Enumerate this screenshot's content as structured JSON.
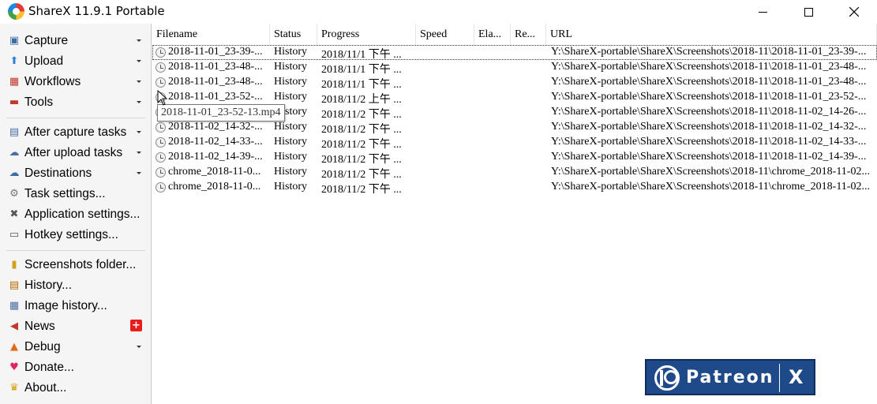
{
  "window": {
    "title": "ShareX 11.9.1 Portable",
    "icons": {
      "app": "sharex-logo-icon",
      "minimize": "minimize-icon",
      "maximize": "maximize-icon",
      "close": "close-icon"
    }
  },
  "sidebar": {
    "groups": [
      [
        {
          "label": "Capture",
          "icon": "capture-icon",
          "submenu": true
        },
        {
          "label": "Upload",
          "icon": "upload-arrow-icon",
          "submenu": true
        },
        {
          "label": "Workflows",
          "icon": "workflows-grid-icon",
          "submenu": true
        },
        {
          "label": "Tools",
          "icon": "toolbox-icon",
          "submenu": true
        }
      ],
      [
        {
          "label": "After capture tasks",
          "icon": "after-capture-icon",
          "submenu": true
        },
        {
          "label": "After upload tasks",
          "icon": "after-upload-icon",
          "submenu": true
        },
        {
          "label": "Destinations",
          "icon": "cloud-destinations-icon",
          "submenu": true
        },
        {
          "label": "Task settings...",
          "icon": "gear-icon",
          "submenu": false
        },
        {
          "label": "Application settings...",
          "icon": "wrench-screwdriver-icon",
          "submenu": false
        },
        {
          "label": "Hotkey settings...",
          "icon": "keyboard-icon",
          "submenu": false
        }
      ],
      [
        {
          "label": "Screenshots folder...",
          "icon": "folder-icon",
          "submenu": false
        },
        {
          "label": "History...",
          "icon": "history-list-icon",
          "submenu": false
        },
        {
          "label": "Image history...",
          "icon": "image-history-icon",
          "submenu": false
        },
        {
          "label": "News",
          "icon": "megaphone-icon",
          "submenu": false,
          "badge": "+"
        },
        {
          "label": "Debug",
          "icon": "traffic-cone-icon",
          "submenu": true
        },
        {
          "label": "Donate...",
          "icon": "heart-icon",
          "submenu": false
        },
        {
          "label": "About...",
          "icon": "crown-icon",
          "submenu": false
        }
      ]
    ]
  },
  "list": {
    "columns": [
      "Filename",
      "Status",
      "Progress",
      "Speed",
      "Ela...",
      "Re...",
      "URL"
    ],
    "rows": [
      [
        "2018-11-01_23-39-...",
        "History",
        "2018/11/1 下午 ...",
        "",
        "",
        "",
        "Y:\\ShareX-portable\\ShareX\\Screenshots\\2018-11\\2018-11-01_23-39-..."
      ],
      [
        "2018-11-01_23-48-...",
        "History",
        "2018/11/1 下午 ...",
        "",
        "",
        "",
        "Y:\\ShareX-portable\\ShareX\\Screenshots\\2018-11\\2018-11-01_23-48-..."
      ],
      [
        "2018-11-01_23-48-...",
        "History",
        "2018/11/1 下午 ...",
        "",
        "",
        "",
        "Y:\\ShareX-portable\\ShareX\\Screenshots\\2018-11\\2018-11-01_23-48-..."
      ],
      [
        "2018-11-01_23-52-...",
        "History",
        "2018/11/2 上午 ...",
        "",
        "",
        "",
        "Y:\\ShareX-portable\\ShareX\\Screenshots\\2018-11\\2018-11-01_23-52-..."
      ],
      [
        "2018-11-01_23-52-13.mp4",
        "History",
        "2018/11/2 下午 ...",
        "",
        "",
        "",
        "Y:\\ShareX-portable\\ShareX\\Screenshots\\2018-11\\2018-11-02_14-26-..."
      ],
      [
        "2018-11-02_14-32-...",
        "History",
        "2018/11/2 下午 ...",
        "",
        "",
        "",
        "Y:\\ShareX-portable\\ShareX\\Screenshots\\2018-11\\2018-11-02_14-32-..."
      ],
      [
        "2018-11-02_14-33-...",
        "History",
        "2018/11/2 下午 ...",
        "",
        "",
        "",
        "Y:\\ShareX-portable\\ShareX\\Screenshots\\2018-11\\2018-11-02_14-33-..."
      ],
      [
        "2018-11-02_14-39-...",
        "History",
        "2018/11/2 下午 ...",
        "",
        "",
        "",
        "Y:\\ShareX-portable\\ShareX\\Screenshots\\2018-11\\2018-11-02_14-39-..."
      ],
      [
        "chrome_2018-11-0...",
        "History",
        "2018/11/2 下午 ...",
        "",
        "",
        "",
        "Y:\\ShareX-portable\\ShareX\\Screenshots\\2018-11\\chrome_2018-11-02..."
      ],
      [
        "chrome_2018-11-0...",
        "History",
        "2018/11/2 下午 ...",
        "",
        "",
        "",
        "Y:\\ShareX-portable\\ShareX\\Screenshots\\2018-11\\chrome_2018-11-02..."
      ]
    ],
    "row_icon": "history-clock-icon",
    "tooltip": "2018-11-01_23-52-13.mp4"
  },
  "patreon": {
    "label": "Patreon",
    "close_label": "X",
    "icon": "patreon-logo-icon"
  },
  "colors": {
    "sidebar_bg": "#f5f5f5",
    "patreon_bg": "#1f4a8a",
    "news_badge": "#e81c1c"
  }
}
